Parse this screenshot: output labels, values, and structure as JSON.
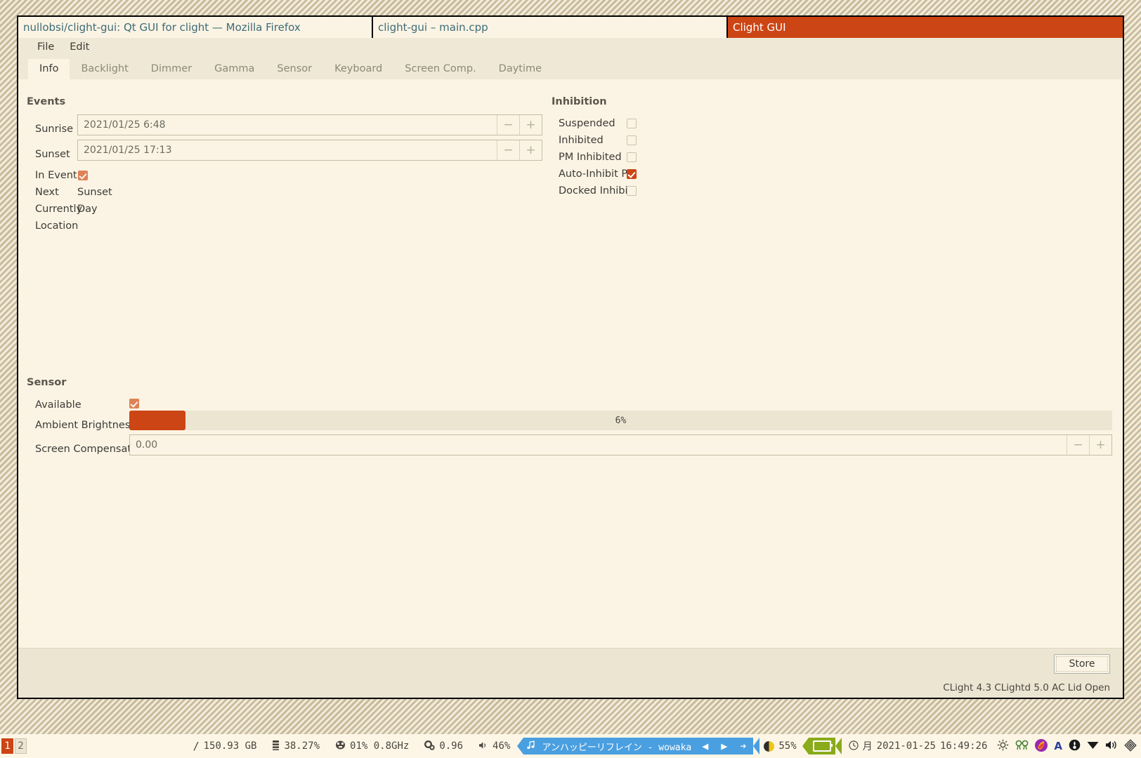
{
  "window": {
    "title_tabs": [
      {
        "label": "nullobsi/clight-gui: Qt GUI for clight — Mozilla Firefox",
        "active": false
      },
      {
        "label": "clight-gui – main.cpp",
        "active": false
      },
      {
        "label": "Clight GUI",
        "active": true
      }
    ],
    "menu": [
      "File",
      "Edit"
    ],
    "accent_color": "#cc4514"
  },
  "tabs": [
    {
      "label": "Info",
      "active": true
    },
    {
      "label": "Backlight",
      "active": false
    },
    {
      "label": "Dimmer",
      "active": false
    },
    {
      "label": "Gamma",
      "active": false
    },
    {
      "label": "Sensor",
      "active": false
    },
    {
      "label": "Keyboard",
      "active": false
    },
    {
      "label": "Screen Comp.",
      "active": false
    },
    {
      "label": "Daytime",
      "active": false
    }
  ],
  "events": {
    "title": "Events",
    "sunrise": {
      "label": "Sunrise",
      "value": "2021/01/25 6:48",
      "minus": "−",
      "plus": "+"
    },
    "sunset": {
      "label": "Sunset",
      "value": "2021/01/25 17:13",
      "minus": "−",
      "plus": "+"
    },
    "in_event": {
      "label": "In Event",
      "checked": true
    },
    "next": {
      "label": "Next",
      "value": "Sunset"
    },
    "currently": {
      "label": "Currently",
      "value": "Day"
    },
    "location": {
      "label": "Location",
      "value": ""
    }
  },
  "inhibition": {
    "title": "Inhibition",
    "items": [
      {
        "label": "Suspended",
        "checked": false
      },
      {
        "label": "Inhibited",
        "checked": false
      },
      {
        "label": "PM Inhibited",
        "checked": false
      },
      {
        "label": "Auto-Inhibit PM",
        "checked": true
      },
      {
        "label": "Docked Inhibit",
        "checked": false
      }
    ]
  },
  "sensor": {
    "title": "Sensor",
    "available": {
      "label": "Available",
      "checked": true
    },
    "ambient_brightness": {
      "label": "Ambient Brightness",
      "percent": 6,
      "percent_text": "6%"
    },
    "screen_compensation": {
      "label": "Screen Compensation",
      "value": "0.00",
      "minus": "−",
      "plus": "+"
    }
  },
  "footer": {
    "store_label": "Store",
    "status": "CLight 4.3  CLightd 5.0  AC  Lid Open"
  },
  "taskbar": {
    "desktops": [
      {
        "label": "1",
        "active": true
      },
      {
        "label": "2",
        "active": false
      }
    ],
    "disk": {
      "icon": "/",
      "value": "150.93 GB"
    },
    "memory": {
      "icon": "memory-icon",
      "value": "38.27%"
    },
    "cpu": {
      "icon": "cpu-icon",
      "value": "01% 0.8GHz"
    },
    "load": {
      "icon": "gears-icon",
      "value": "0.96"
    },
    "volume": {
      "icon": "speaker-icon",
      "value": "46%"
    },
    "music": {
      "icon": "note-icon",
      "title": "アンハッピーリフレイン  -  wowaka",
      "prev": "◀",
      "play": "▶",
      "next": "➔"
    },
    "brightness": {
      "icon": "moon-icon",
      "value": "55%"
    },
    "battery": {
      "icon": "battery-icon"
    },
    "clock": {
      "icon": "clock-icon",
      "day": "月",
      "date": "2021-01-25",
      "time": "16:49:26"
    },
    "tray": [
      "sun-icon",
      "glasses-icon",
      "colorful-icon",
      "letter-a-icon",
      "circle-icon",
      "triangle-down-icon",
      "volume-icon",
      "layers-icon"
    ]
  }
}
